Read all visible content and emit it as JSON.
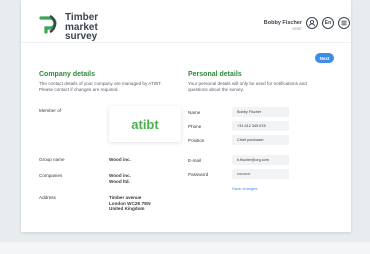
{
  "brand": {
    "name": [
      "Timber",
      "market",
      "survey"
    ]
  },
  "user": {
    "name": "Bobby Fischer",
    "company": "ATIBT"
  },
  "header_icons": {
    "lang": "En"
  },
  "actions": {
    "next": "Next",
    "save_changes": "Save changes"
  },
  "company": {
    "title": "Company details",
    "description": "The contact details of your company are managed by ATIBT. Please contact if changes are required.",
    "member_of_label": "Member of",
    "member_logo": "atibt",
    "group_label": "Group name",
    "group_value": "Wood inc.",
    "companies_label": "Companies",
    "companies_value": [
      "Wood inc.",
      "Wood ltd."
    ],
    "address_label": "Address",
    "address_value": [
      "Timber avenue",
      "London WC2E 7EN",
      "United Kingdom"
    ]
  },
  "personal": {
    "title": "Personal details",
    "description": "Your personal details will only be used for notifications and questions about the survey.",
    "name_label": "Name",
    "name_value": "Bobby Fischer",
    "phone_label": "Phone",
    "phone_value": "+31 612 345 678",
    "position_label": "Position",
    "position_value": "Chief purchaser",
    "email_label": "E-mail",
    "email_value": "b.fischer@org.com",
    "password_label": "Password",
    "password_value": "••••••••••"
  }
}
